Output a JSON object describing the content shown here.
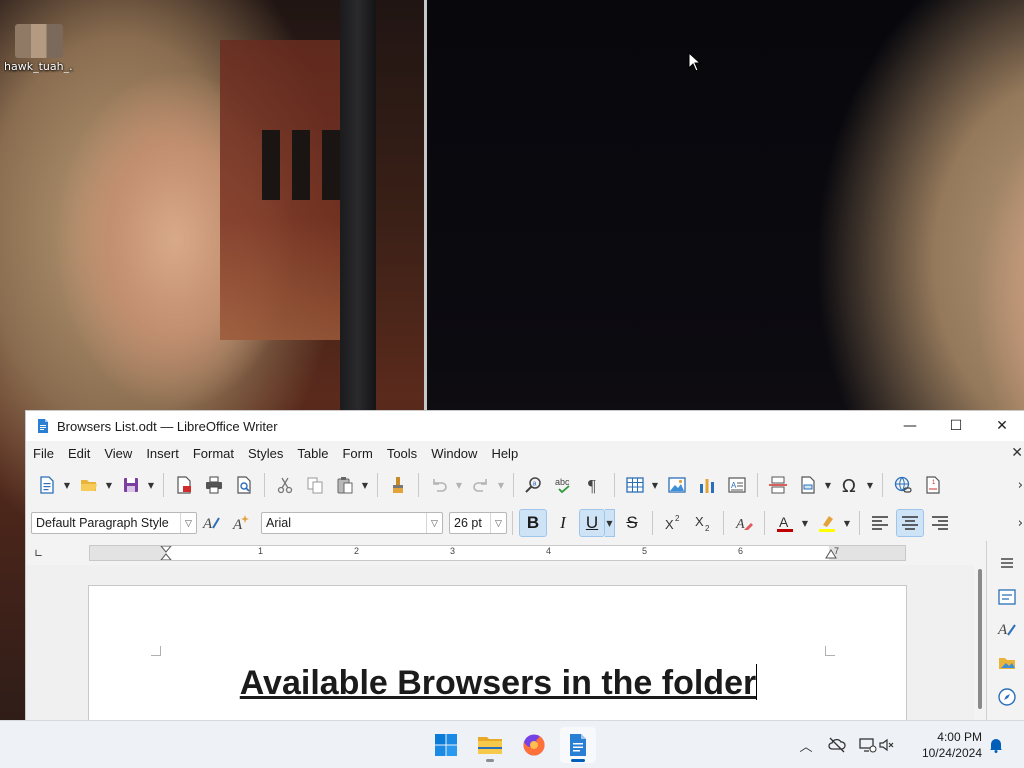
{
  "desktop": {
    "icon_label": "hawk_tuah_..."
  },
  "window": {
    "title": "Browsers List.odt — LibreOffice Writer",
    "minimize": "—",
    "maximize": "☐",
    "close": "✕"
  },
  "menu": {
    "items": [
      "File",
      "Edit",
      "View",
      "Insert",
      "Format",
      "Styles",
      "Table",
      "Form",
      "Tools",
      "Window",
      "Help"
    ],
    "close_doc": "✕"
  },
  "format_bar": {
    "paragraph_style": "Default Paragraph Style",
    "font_name": "Arial",
    "font_size": "26 pt",
    "bold": "B",
    "italic": "I",
    "underline": "U",
    "strike": "S"
  },
  "ruler": {
    "numbers": [
      "1",
      "2",
      "3",
      "4",
      "5",
      "6",
      "7"
    ]
  },
  "document": {
    "heading": "Available Browsers in the folder"
  },
  "taskbar": {
    "time": "4:00 PM",
    "date": "10/24/2024"
  },
  "colors": {
    "accent": "#005fb8",
    "toggle_active": "#cfe3f6",
    "font_color": "#c00000",
    "highlight_color": "#ffff00"
  }
}
